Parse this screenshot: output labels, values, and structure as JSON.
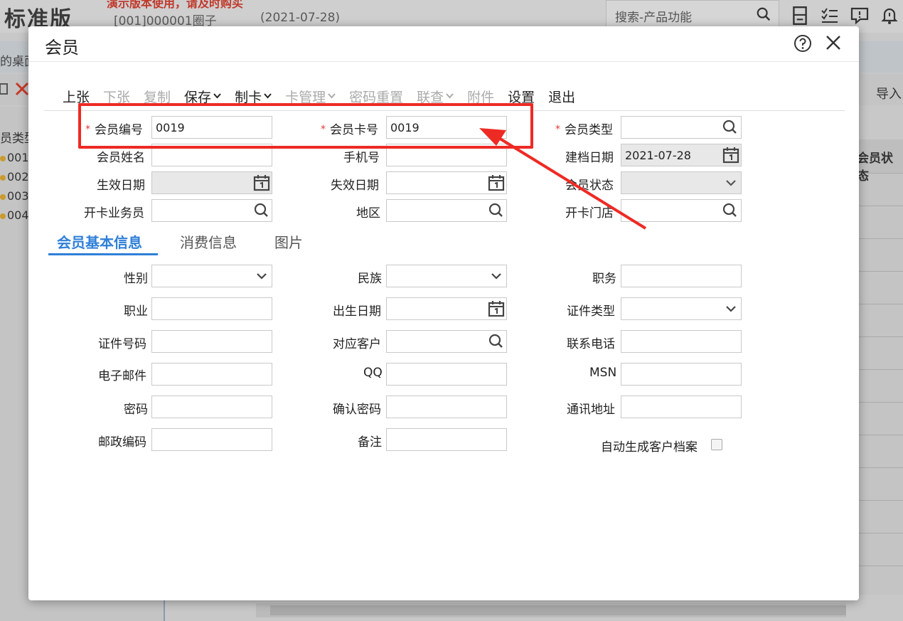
{
  "background": {
    "logo": "标准版",
    "warning": "演示版本使用，请及时购买",
    "org": "[001]000001圈子",
    "date": "(2021-07-28)",
    "search_placeholder": "搜索-产品功能",
    "tab_left": "的桌面",
    "import_label": "导入",
    "left_header": "员类型",
    "left_items": [
      "001",
      "002",
      "003",
      "004"
    ],
    "grid_header": "会员状态"
  },
  "dialog": {
    "title": "会员",
    "toolbar": [
      {
        "label": "上张",
        "disabled": false,
        "dropdown": false
      },
      {
        "label": "下张",
        "disabled": true,
        "dropdown": false
      },
      {
        "label": "复制",
        "disabled": true,
        "dropdown": false
      },
      {
        "label": "保存",
        "disabled": false,
        "dropdown": true
      },
      {
        "label": "制卡",
        "disabled": false,
        "dropdown": true
      },
      {
        "label": "卡管理",
        "disabled": true,
        "dropdown": true
      },
      {
        "label": "密码重置",
        "disabled": true,
        "dropdown": false
      },
      {
        "label": "联查",
        "disabled": true,
        "dropdown": true
      },
      {
        "label": "附件",
        "disabled": true,
        "dropdown": false
      },
      {
        "label": "设置",
        "disabled": false,
        "dropdown": false
      },
      {
        "label": "退出",
        "disabled": false,
        "dropdown": false
      }
    ],
    "header_fields": {
      "member_no": {
        "label": "会员编号",
        "value": "0019",
        "required": true
      },
      "card_no": {
        "label": "会员卡号",
        "value": "0019",
        "required": true
      },
      "member_type": {
        "label": "会员类型",
        "value": "",
        "required": true
      },
      "member_name": {
        "label": "会员姓名",
        "value": ""
      },
      "mobile": {
        "label": "手机号",
        "value": ""
      },
      "created_date": {
        "label": "建档日期",
        "value": "2021-07-28"
      },
      "effective_date": {
        "label": "生效日期",
        "value": ""
      },
      "expire_date": {
        "label": "失效日期",
        "value": ""
      },
      "member_status": {
        "label": "会员状态",
        "value": ""
      },
      "clerk": {
        "label": "开卡业务员",
        "value": ""
      },
      "region": {
        "label": "地区",
        "value": ""
      },
      "store": {
        "label": "开卡门店",
        "value": ""
      }
    },
    "tabs": [
      "会员基本信息",
      "消费信息",
      "图片"
    ],
    "basic_fields": {
      "gender": "性别",
      "ethnicity": "民族",
      "position": "职务",
      "occupation": "职业",
      "birthday": "出生日期",
      "id_type": "证件类型",
      "id_no": "证件号码",
      "customer": "对应客户",
      "phone": "联系电话",
      "email": "电子邮件",
      "qq": "QQ",
      "msn": "MSN",
      "password": "密码",
      "confirm_password": "确认密码",
      "address": "通讯地址",
      "postcode": "邮政编码",
      "remark": "备注",
      "auto_customer": "自动生成客户档案"
    }
  },
  "colors": {
    "accent": "#2f7fd8",
    "annotation": "#ee2a24",
    "required": "#e23a3a"
  }
}
